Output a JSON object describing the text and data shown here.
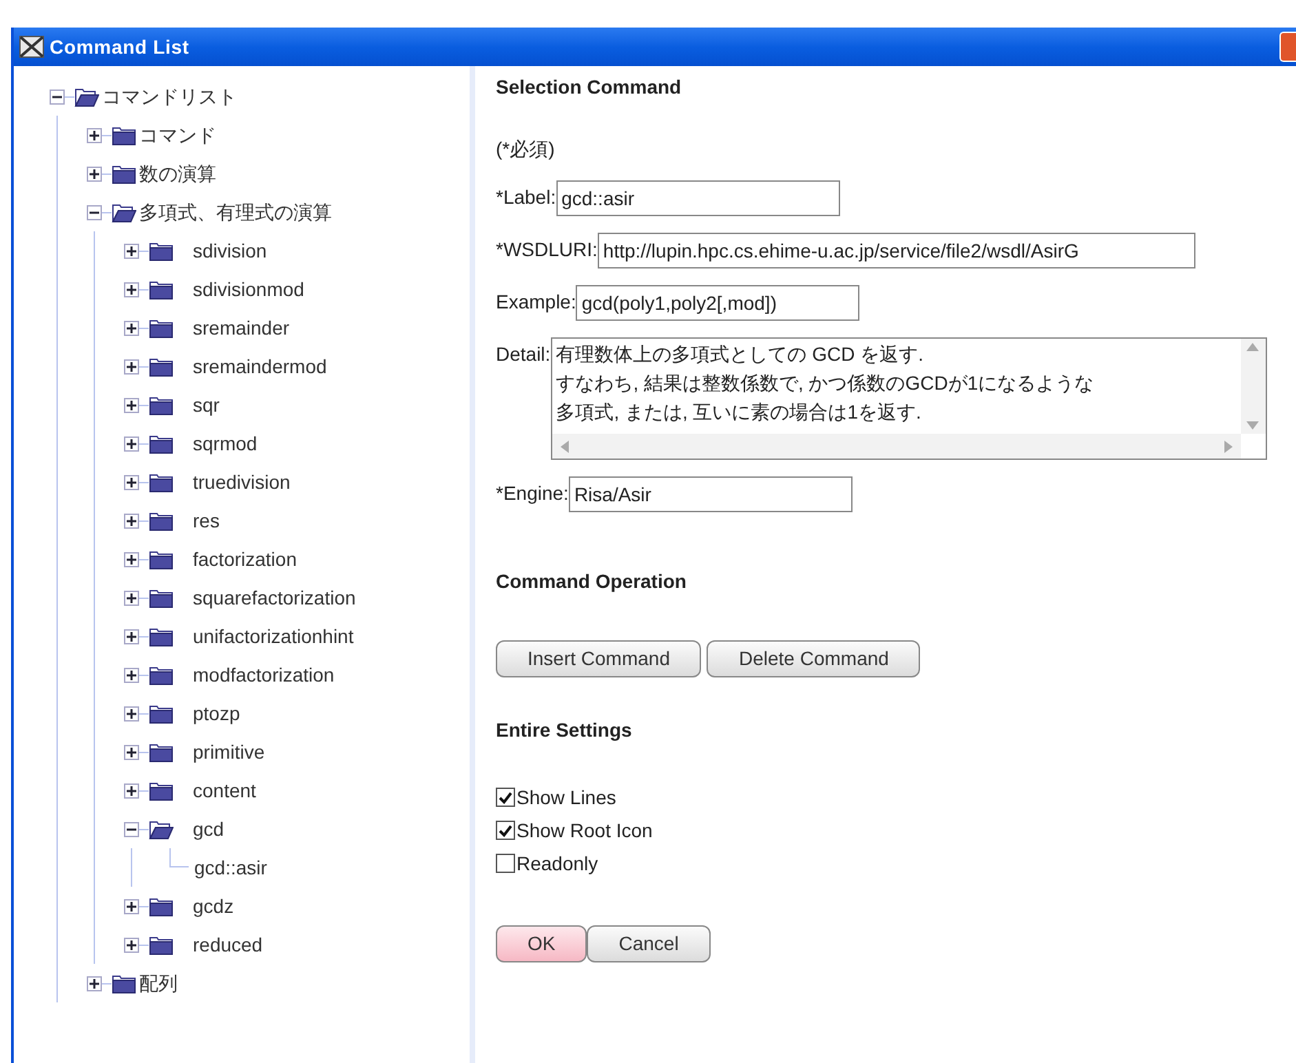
{
  "window": {
    "title": "Command List"
  },
  "tree": [
    {
      "label": "コマンドリスト",
      "kind": "folder",
      "expanded": true,
      "children": [
        {
          "label": "コマンド",
          "kind": "folder",
          "expanded": false
        },
        {
          "label": "数の演算",
          "kind": "folder",
          "expanded": false
        },
        {
          "label": "多項式、有理式の演算",
          "kind": "folder",
          "expanded": true,
          "children": [
            {
              "label": "sdivision",
              "kind": "folder",
              "expanded": false
            },
            {
              "label": "sdivisionmod",
              "kind": "folder",
              "expanded": false
            },
            {
              "label": "sremainder",
              "kind": "folder",
              "expanded": false
            },
            {
              "label": "sremaindermod",
              "kind": "folder",
              "expanded": false
            },
            {
              "label": "sqr",
              "kind": "folder",
              "expanded": false
            },
            {
              "label": "sqrmod",
              "kind": "folder",
              "expanded": false
            },
            {
              "label": "truedivision",
              "kind": "folder",
              "expanded": false
            },
            {
              "label": "res",
              "kind": "folder",
              "expanded": false
            },
            {
              "label": "factorization",
              "kind": "folder",
              "expanded": false
            },
            {
              "label": "squarefactorization",
              "kind": "folder",
              "expanded": false
            },
            {
              "label": "unifactorizationhint",
              "kind": "folder",
              "expanded": false
            },
            {
              "label": "modfactorization",
              "kind": "folder",
              "expanded": false
            },
            {
              "label": "ptozp",
              "kind": "folder",
              "expanded": false
            },
            {
              "label": "primitive",
              "kind": "folder",
              "expanded": false
            },
            {
              "label": "content",
              "kind": "folder",
              "expanded": false
            },
            {
              "label": "gcd",
              "kind": "folder",
              "expanded": true,
              "children": [
                {
                  "label": "gcd::asir",
                  "kind": "leaf"
                }
              ]
            },
            {
              "label": "gcdz",
              "kind": "folder",
              "expanded": false
            },
            {
              "label": "reduced",
              "kind": "folder",
              "expanded": false
            }
          ]
        },
        {
          "label": "配列",
          "kind": "folder",
          "expanded": false
        }
      ]
    }
  ],
  "selection": {
    "heading": "Selection Command",
    "note": "(*必須)",
    "fields": [
      {
        "label": "*Label:",
        "value": "gcd::asir",
        "kind": "input"
      },
      {
        "label": "*WSDLURI:",
        "value": "http://lupin.hpc.cs.ehime-u.ac.jp/service/file2/wsdl/AsirG",
        "kind": "long_input"
      },
      {
        "label": "Example:",
        "value": "gcd(poly1,poly2[,mod])",
        "kind": "input"
      },
      {
        "label": "Detail:",
        "lines": [
          "有理数体上の多項式としての GCD を返す.",
          "すなわち, 結果は整数係数で, かつ係数のGCDが1になるような",
          "多項式, または, 互いに素の場合は1を返す."
        ],
        "kind": "textarea"
      },
      {
        "label": "*Engine:",
        "value": "Risa/Asir",
        "kind": "input"
      }
    ]
  },
  "operation": {
    "heading": "Command Operation",
    "buttons": [
      {
        "label": "Insert Command",
        "focused": false
      },
      {
        "label": "Delete Command",
        "focused": false
      }
    ]
  },
  "settings": {
    "heading": "Entire Settings",
    "options": [
      {
        "label": "Show Lines",
        "checked": true
      },
      {
        "label": "Show Root Icon",
        "checked": true
      },
      {
        "label": "Readonly",
        "checked": false
      }
    ]
  },
  "dialog_buttons": [
    {
      "label": "OK",
      "focused": true
    },
    {
      "label": "Cancel",
      "focused": false
    }
  ]
}
